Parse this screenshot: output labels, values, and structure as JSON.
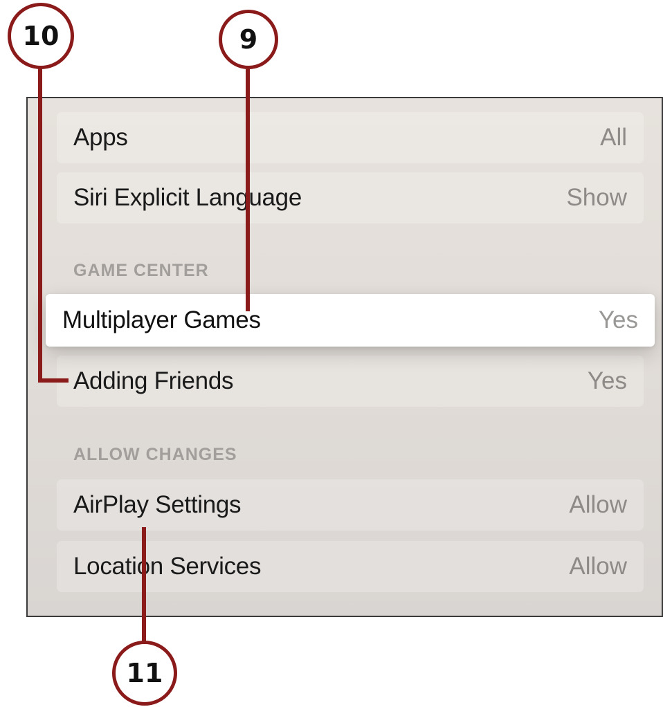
{
  "settings": {
    "rows_top": [
      {
        "label": "Apps",
        "value": "All"
      },
      {
        "label": "Siri Explicit Language",
        "value": "Show"
      }
    ],
    "game_center": {
      "header": "GAME CENTER",
      "rows": [
        {
          "label": "Multiplayer Games",
          "value": "Yes",
          "focused": true
        },
        {
          "label": "Adding Friends",
          "value": "Yes"
        }
      ]
    },
    "allow_changes": {
      "header": "ALLOW CHANGES",
      "rows": [
        {
          "label": "AirPlay Settings",
          "value": "Allow"
        },
        {
          "label": "Location Services",
          "value": "Allow"
        }
      ]
    }
  },
  "callouts": {
    "multiplayer": "9",
    "adding_friends": "10",
    "airplay": "11"
  },
  "colors": {
    "callout": "#8b1a1a",
    "focus_background": "#ffffff",
    "screen_background": "#e4dfda"
  }
}
